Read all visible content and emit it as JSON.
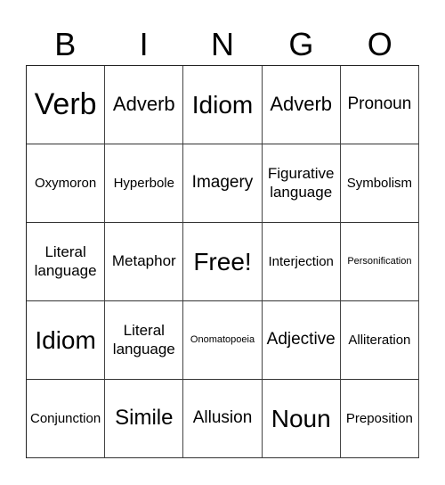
{
  "header": [
    "B",
    "I",
    "N",
    "G",
    "O"
  ],
  "rows": [
    [
      {
        "text": "Verb",
        "size": "xl"
      },
      {
        "text": "Adverb",
        "size": "m"
      },
      {
        "text": "Idiom",
        "size": "l"
      },
      {
        "text": "Adverb",
        "size": "m"
      },
      {
        "text": "Pronoun",
        "size": "n"
      }
    ],
    [
      {
        "text": "Oxymoron",
        "size": "xs"
      },
      {
        "text": "Hyperbole",
        "size": "xs"
      },
      {
        "text": "Imagery",
        "size": "n"
      },
      {
        "text": "Figurative language",
        "size": "s"
      },
      {
        "text": "Symbolism",
        "size": "xs"
      }
    ],
    [
      {
        "text": "Literal language",
        "size": "s"
      },
      {
        "text": "Metaphor",
        "size": "s"
      },
      {
        "text": "Free!",
        "size": "l"
      },
      {
        "text": "Interjection",
        "size": "xs"
      },
      {
        "text": "Personification",
        "size": "xxs"
      }
    ],
    [
      {
        "text": "Idiom",
        "size": "l"
      },
      {
        "text": "Literal language",
        "size": "s"
      },
      {
        "text": "Onomatopoeia",
        "size": "xxs"
      },
      {
        "text": "Adjective",
        "size": "n"
      },
      {
        "text": "Alliteration",
        "size": "xs"
      }
    ],
    [
      {
        "text": "Conjunction",
        "size": "xs"
      },
      {
        "text": "Simile",
        "size": "ml"
      },
      {
        "text": "Allusion",
        "size": "n"
      },
      {
        "text": "Noun",
        "size": "l"
      },
      {
        "text": "Preposition",
        "size": "xs"
      }
    ]
  ]
}
